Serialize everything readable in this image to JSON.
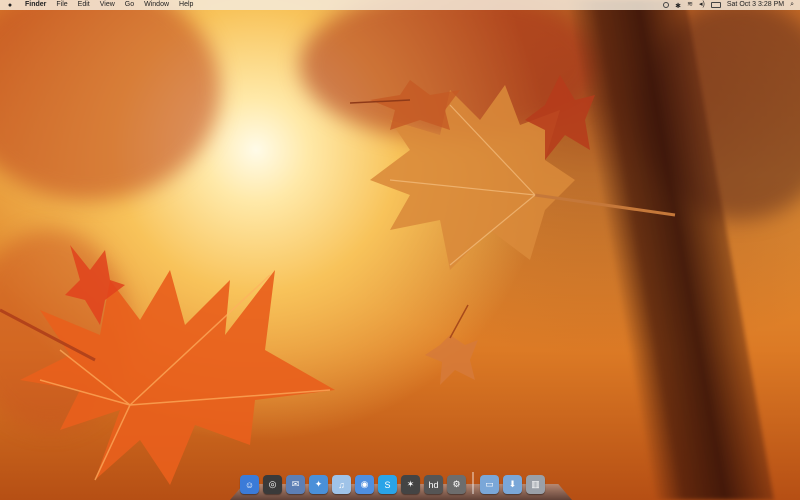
{
  "menubar": {
    "apple_icon": "apple-icon",
    "menus": [
      {
        "name": "app",
        "label": "Finder"
      },
      {
        "name": "edit",
        "label": "Edit"
      },
      {
        "name": "file",
        "label": "File"
      },
      {
        "name": "view",
        "label": "View"
      },
      {
        "name": "go",
        "label": "Go"
      },
      {
        "name": "window",
        "label": "Window"
      },
      {
        "name": "help",
        "label": "Help"
      }
    ],
    "status": {
      "datetime": "Sat Oct 3  3:28 PM",
      "icons": [
        "time-machine-icon",
        "bluetooth-icon",
        "wifi-icon",
        "volume-icon",
        "battery-icon",
        "spotlight-icon"
      ]
    }
  },
  "dock": {
    "apps": [
      {
        "name": "finder",
        "icon": "finder-icon",
        "color": "#3b7bd8",
        "glyph": "☺"
      },
      {
        "name": "dashboard",
        "icon": "dashboard-icon",
        "color": "#3a3a3a",
        "glyph": "◎"
      },
      {
        "name": "mail",
        "icon": "mail-icon",
        "color": "#5d7fb5",
        "glyph": "✉"
      },
      {
        "name": "safari",
        "icon": "safari-icon",
        "color": "#4a90d9",
        "glyph": "✦"
      },
      {
        "name": "itunes",
        "icon": "itunes-icon",
        "color": "#9fc3e8",
        "glyph": "♫"
      },
      {
        "name": "ichat",
        "icon": "ichat-icon",
        "color": "#4f8fe0",
        "glyph": "◉"
      },
      {
        "name": "skype",
        "icon": "skype-icon",
        "color": "#2aa4e8",
        "glyph": "S"
      },
      {
        "name": "app-star",
        "icon": "star-app-icon",
        "color": "#444",
        "glyph": "✶"
      },
      {
        "name": "hd-app",
        "icon": "hd-icon",
        "color": "#555",
        "glyph": "hd"
      },
      {
        "name": "preferences",
        "icon": "gear-icon",
        "color": "#6d6d6d",
        "glyph": "⚙"
      }
    ],
    "stacks": [
      {
        "name": "applications",
        "icon": "folder-icon",
        "color": "#7aa7d8",
        "glyph": "▭"
      },
      {
        "name": "downloads",
        "icon": "downloads-folder-icon",
        "color": "#7aa7d8",
        "glyph": "⬇"
      },
      {
        "name": "trash",
        "icon": "trash-icon",
        "color": "#9aa0a8",
        "glyph": "▥"
      }
    ]
  }
}
